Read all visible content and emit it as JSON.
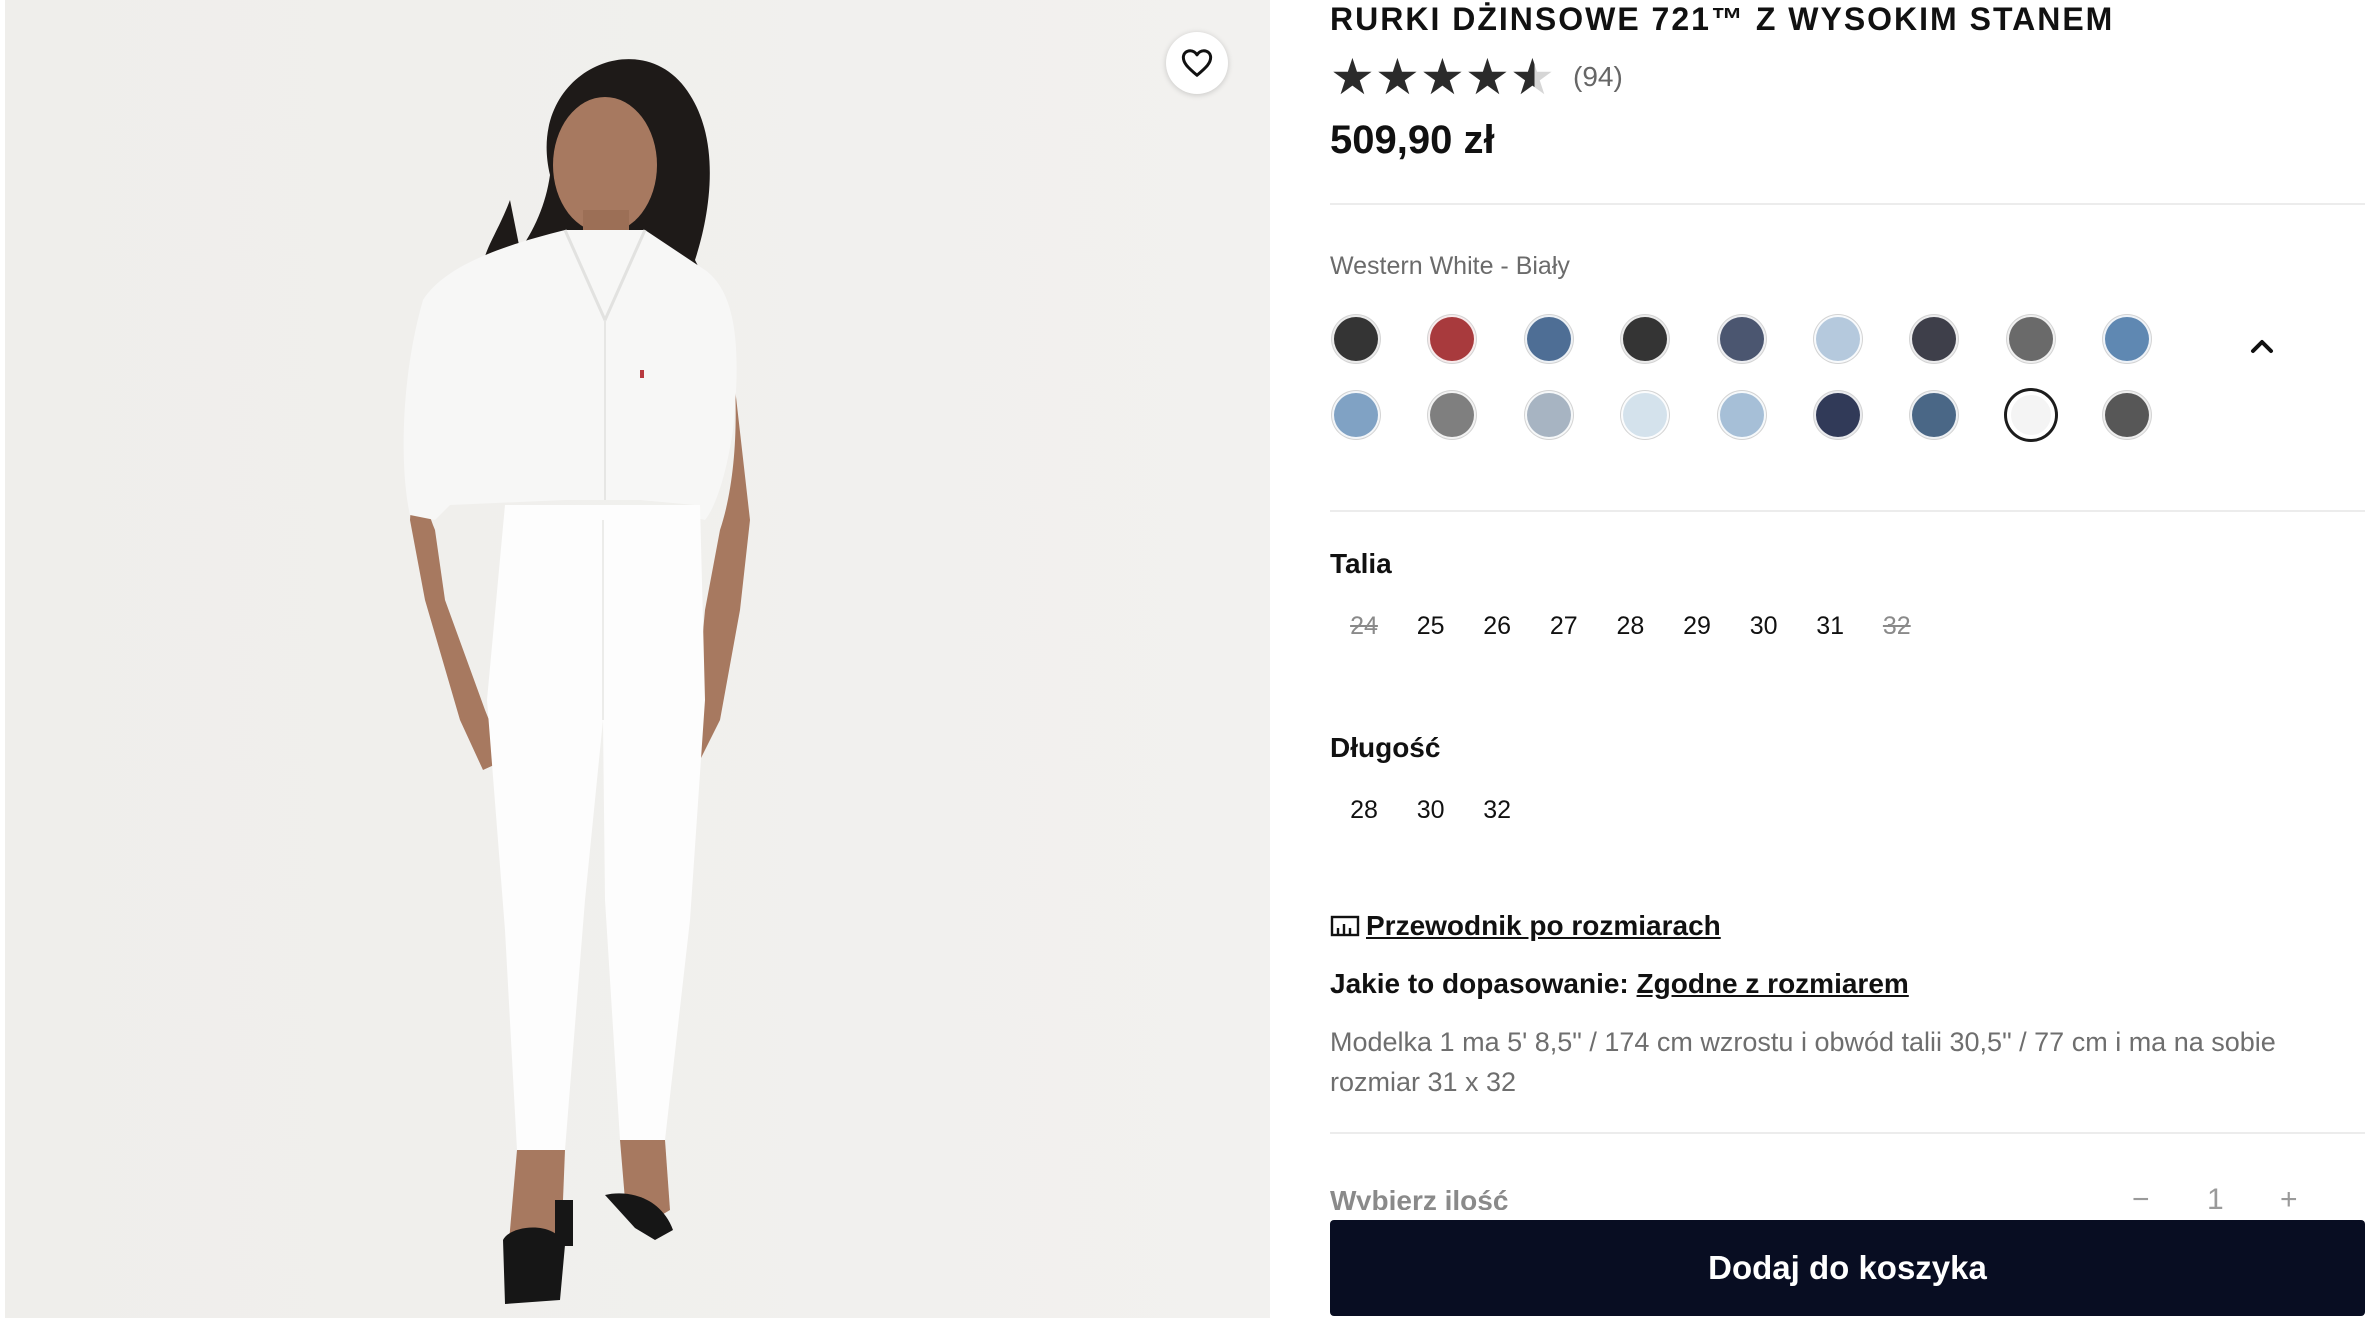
{
  "product": {
    "title": "RURKI DŻINSOWE 721™ Z WYSOKIM STANEM",
    "rating": 4.5,
    "rating_max": 5,
    "review_count": "(94)",
    "price": "509,90 zł"
  },
  "gallery": {
    "favorite_icon": "heart-icon"
  },
  "color": {
    "selected_name": "Western White - Biały",
    "swatches": [
      "#343434",
      "#a83a3d",
      "#4e6e95",
      "#343434",
      "#4b5670",
      "#b5c9dd",
      "#3e3f4a",
      "#6a6a6a",
      "#5f88b2",
      "#80a2c4",
      "#7f7f7f",
      "#a7b4c2",
      "#d4e2ec",
      "#a6bfd7",
      "#313a58",
      "#4a6786",
      "#f4f4f4",
      "#575757"
    ],
    "selected_index": 16,
    "collapse_icon": "chevron-up-icon"
  },
  "waist": {
    "label": "Talia",
    "options": [
      {
        "value": "24",
        "available": false
      },
      {
        "value": "25",
        "available": true
      },
      {
        "value": "26",
        "available": true
      },
      {
        "value": "27",
        "available": true
      },
      {
        "value": "28",
        "available": true
      },
      {
        "value": "29",
        "available": true
      },
      {
        "value": "30",
        "available": true
      },
      {
        "value": "31",
        "available": true
      },
      {
        "value": "32",
        "available": false
      }
    ]
  },
  "length": {
    "label": "Długość",
    "options": [
      {
        "value": "28",
        "available": true
      },
      {
        "value": "30",
        "available": true
      },
      {
        "value": "32",
        "available": true
      }
    ]
  },
  "size_guide": {
    "label": "Przewodnik po rozmiarach",
    "icon": "ruler-icon"
  },
  "fit": {
    "label": "Jakie to dopasowanie: ",
    "value": "Zgodne z rozmiarem"
  },
  "model_info": "Modelka 1 ma 5' 8,5\" / 174 cm wzrostu i obwód talii 30,5\" / 77 cm i ma na sobie rozmiar 31 x 32",
  "quantity": {
    "label": "Wybierz ilość",
    "value": "1",
    "minus": "−",
    "plus": "+"
  },
  "cart": {
    "button_label": "Dodaj do koszyka",
    "color": "#080d22"
  }
}
